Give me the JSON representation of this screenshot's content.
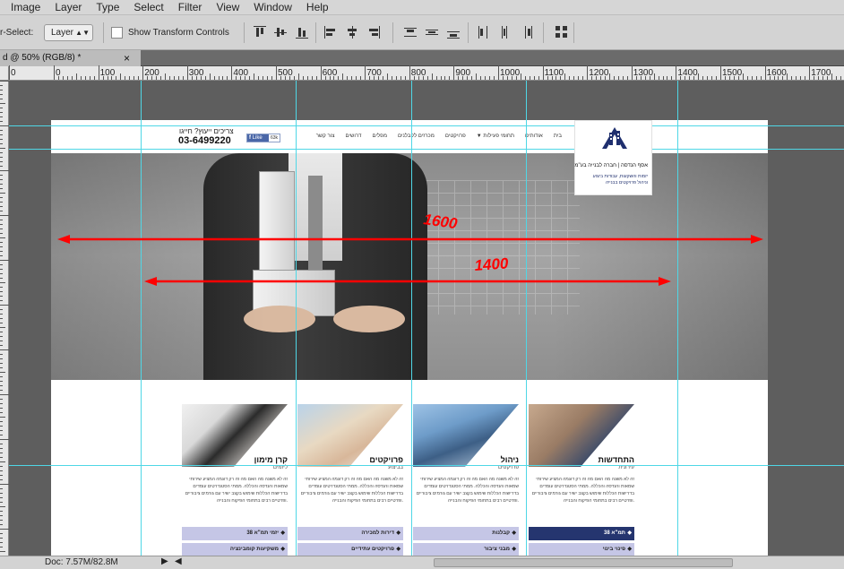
{
  "menubar": {
    "items": [
      "Image",
      "Layer",
      "Type",
      "Select",
      "Filter",
      "View",
      "Window",
      "Help"
    ]
  },
  "options": {
    "auto_select_label": "r-Select:",
    "layer_value": "Layer",
    "show_transform_label": "Show Transform Controls"
  },
  "document_tab": {
    "title": "d @ 50% (RGB/8) *"
  },
  "ruler": {
    "labels": [
      "0",
      "0",
      "100",
      "200",
      "300",
      "400",
      "500",
      "600",
      "700",
      "800",
      "900",
      "1000",
      "1100",
      "1200",
      "1300",
      "1400",
      "1500",
      "1600",
      "1700"
    ]
  },
  "site": {
    "nav": [
      "בית",
      "אודותינו",
      "תחומי פעילות",
      "פרויקטים",
      "מכרזים לקבלנים",
      "מפלים",
      "דרושים",
      "צור קשר"
    ],
    "phone_label": "צריכים ייעוץ? חייגו",
    "phone": "03-6499220",
    "fb_like": "Like",
    "fb_count": "63k",
    "logo_name": "אסף הנדסה | חברה לבנייה בע\"מ",
    "logo_line1": "יזמות והשקעות, עבודות ביצוע",
    "logo_line2": "וניהול פרויקטים בבנייה",
    "annotation_1600": "1600",
    "annotation_1400": "1400",
    "cards": [
      {
        "title": "התחדשות",
        "subtitle": "עירונית",
        "text": "זה לא משנה מה האם מה זה רק דוגמה המציע שירותי שמאות והנדסה והכללה. ממתי הסטנדרטים עומדים בדרישות הכללות שימוש בקצב ישיר עם גורמים ציבוריים ופרטיים רבים בתחומי הפיקוח והבנייה.",
        "btn1": "תמ\"א 38",
        "btn2": "פינוי בינוי",
        "btn1_color": "#25356f",
        "btn2_color": "#c5c6e6"
      },
      {
        "title": "ניהול",
        "subtitle": "פרויקטים",
        "text": "זה לא משנה מה האם מה זה רק דוגמה המציע שירותי שמאות והנדסה והכללה. ממתי הסטנדרטים עומדים בדרישות הכללות שימוש בקצב ישיר עם גורמים ציבוריים ופרטיים רבים בתחומי הפיקוח והבנייה.",
        "btn1": "קבלנות",
        "btn2": "מבני ציבור",
        "btn1_color": "#c5c6e6",
        "btn2_color": "#c5c6e6"
      },
      {
        "title": "פרויקטים",
        "subtitle": "בביצוע",
        "text": "זה לא משנה מה האם מה זה רק דוגמה המציע שירותי שמאות והנדסה והכללה. ממתי הסטנדרטים עומדים בדרישות הכללות שימוש בקצב ישיר עם גורמים ציבוריים ופרטיים רבים בתחומי הפיקוח והבנייה.",
        "btn1": "דירות למכירה",
        "btn2": "פרויקטים עתידיים",
        "btn1_color": "#c5c6e6",
        "btn2_color": "#c5c6e6"
      },
      {
        "title": "קרן מימון",
        "subtitle": "ליזמים",
        "text": "זה לא משנה מה האם מה זה רק דוגמה המציע שירותי שמאות והנדסה והכללה. ממתי הסטנדרטים עומדים בדרישות הכללות שימוש בקצב ישיר עם גורמים ציבוריים ופרטיים רבים בתחומי הפיקוח והבנייה.",
        "btn1": "יזמי תמ\"א 38",
        "btn2": "משקיעות קומבינציה",
        "btn1_color": "#c5c6e6",
        "btn2_color": "#c5c6e6"
      }
    ]
  },
  "status": {
    "doc": "Doc: 7.57M/82.8M"
  },
  "colors": {
    "guide": "#4fd7e6",
    "annotation": "#ff0000"
  }
}
